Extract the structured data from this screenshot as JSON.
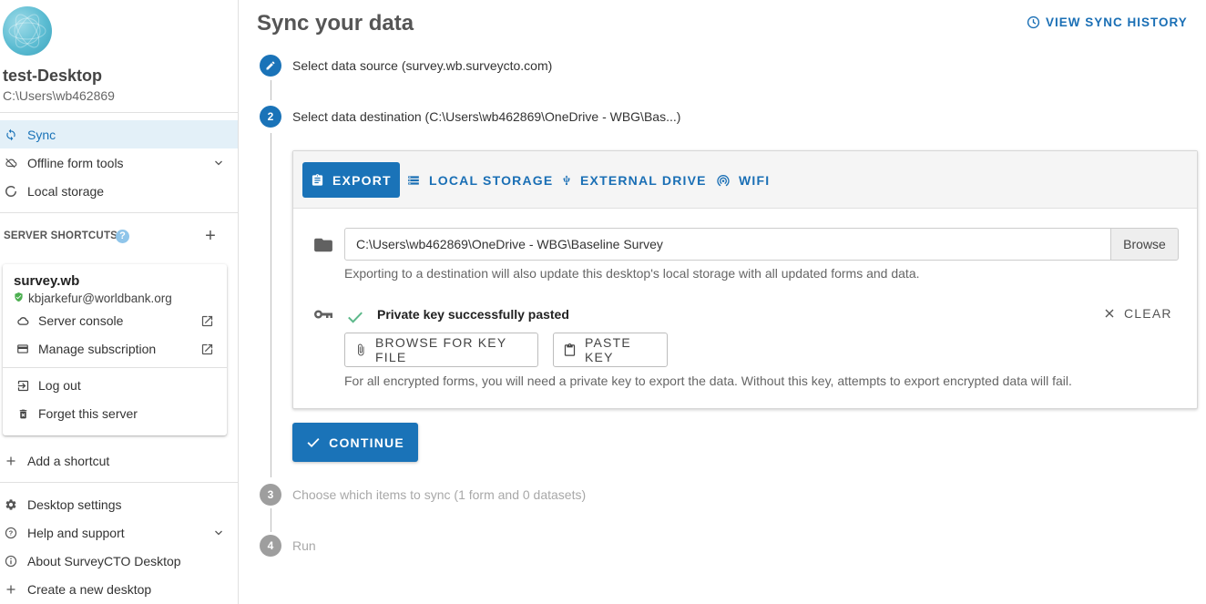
{
  "sidebar": {
    "desktop_name": "test-Desktop",
    "desktop_path": "C:\\Users\\wb462869",
    "nav": [
      {
        "label": "Sync",
        "icon": "sync-icon",
        "active": true
      },
      {
        "label": "Offline form tools",
        "icon": "cloud-off-icon",
        "expandable": true
      },
      {
        "label": "Local storage",
        "icon": "circle-icon"
      }
    ],
    "shortcuts_title": "SERVER SHORTCUTS",
    "help_badge": "?",
    "add_symbol": "+",
    "server": {
      "name": "survey.wb",
      "user": "kbjarkefur@worldbank.org",
      "items": [
        {
          "label": "Server console",
          "icon": "cloud-icon"
        },
        {
          "label": "Manage subscription",
          "icon": "credit-card-icon"
        },
        {
          "label": "Log out",
          "icon": "logout-icon"
        },
        {
          "label": "Forget this server",
          "icon": "trash-icon"
        }
      ]
    },
    "add_shortcut": "Add a shortcut",
    "bottom": [
      {
        "label": "Desktop settings",
        "icon": "gear-icon"
      },
      {
        "label": "Help and support",
        "icon": "help-circle-icon",
        "expandable": true
      },
      {
        "label": "About SurveyCTO Desktop",
        "icon": "info-icon"
      },
      {
        "label": "Create a new desktop",
        "icon": "plus-icon"
      }
    ]
  },
  "main": {
    "title": "Sync your data",
    "history_link": "VIEW SYNC HISTORY",
    "steps": [
      {
        "number": "",
        "label": "Select data source (survey.wb.surveycto.com)",
        "state": "done"
      },
      {
        "number": "2",
        "label": "Select data destination (C:\\Users\\wb462869\\OneDrive - WBG\\Bas...)",
        "state": "active"
      },
      {
        "number": "3",
        "label": "Choose which items to sync (1 form and 0 datasets)",
        "state": "disabled"
      },
      {
        "number": "4",
        "label": "Run",
        "state": "disabled"
      }
    ],
    "tabs": [
      {
        "label": "EXPORT",
        "icon": "clipboard-icon",
        "active": true
      },
      {
        "label": "LOCAL STORAGE",
        "icon": "storage-icon"
      },
      {
        "label": "EXTERNAL DRIVE",
        "icon": "usb-icon"
      },
      {
        "label": "WIFI",
        "icon": "wifi-tethering-icon"
      }
    ],
    "path_value": "C:\\Users\\wb462869\\OneDrive - WBG\\Baseline Survey",
    "browse_label": "Browse",
    "export_hint": "Exporting to a destination will also update this desktop's local storage with all updated forms and data.",
    "key_status": "Private key successfully pasted",
    "clear_label": "CLEAR",
    "browse_key_label": "BROWSE FOR KEY FILE",
    "paste_key_label": "PASTE KEY",
    "key_hint": "For all encrypted forms, you will need a private key to export the data. Without this key, attempts to export encrypted data will fail.",
    "continue_label": "CONTINUE"
  },
  "colors": {
    "accent": "#1a73b8",
    "active_nav_bg": "#e3f0f8",
    "success": "#4caf50",
    "disabled_step": "#9e9e9e"
  }
}
